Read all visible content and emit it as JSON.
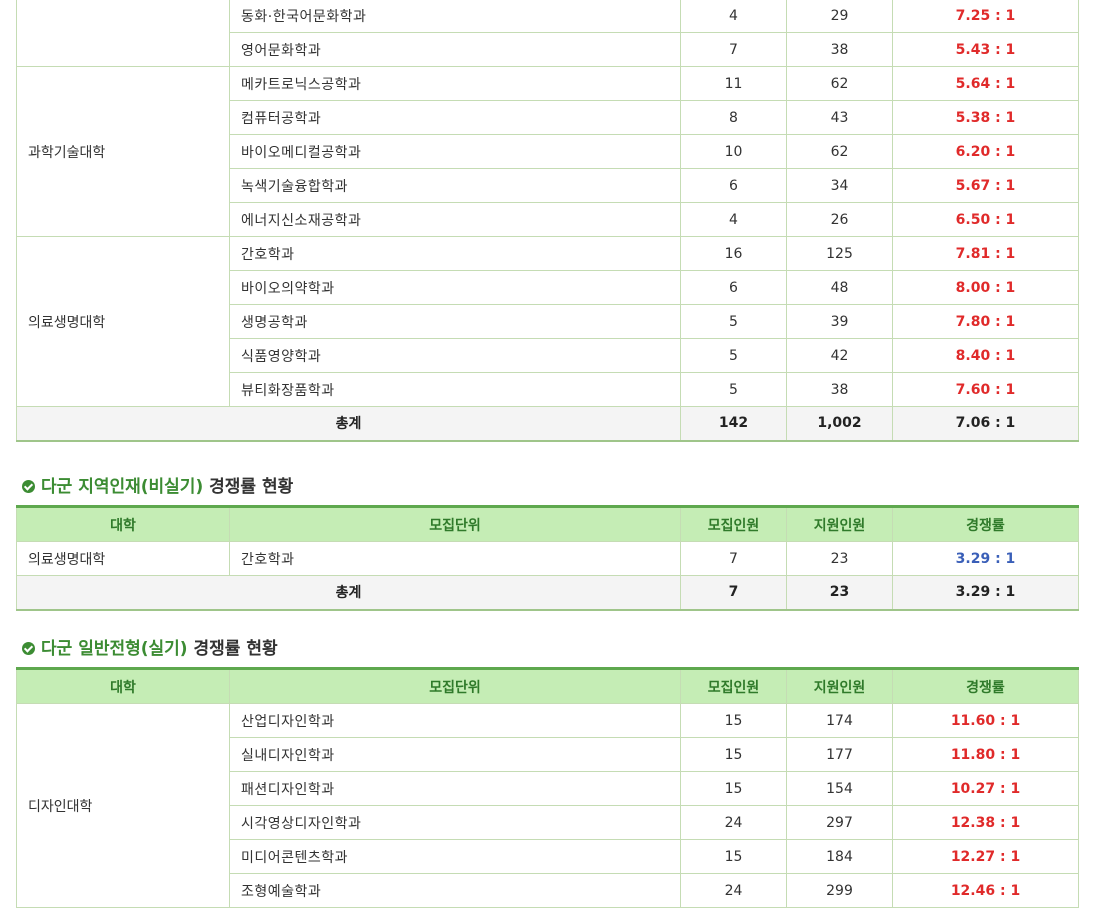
{
  "table1": {
    "groups": [
      {
        "univ": "",
        "rows": [
          {
            "unit": "동화·한국어문화학과",
            "quota": "4",
            "applicants": "29",
            "rate": "7.25 : 1"
          },
          {
            "unit": "영어문화학과",
            "quota": "7",
            "applicants": "38",
            "rate": "5.43 : 1"
          }
        ]
      },
      {
        "univ": "과학기술대학",
        "rows": [
          {
            "unit": "메카트로닉스공학과",
            "quota": "11",
            "applicants": "62",
            "rate": "5.64 : 1"
          },
          {
            "unit": "컴퓨터공학과",
            "quota": "8",
            "applicants": "43",
            "rate": "5.38 : 1"
          },
          {
            "unit": "바이오메디컬공학과",
            "quota": "10",
            "applicants": "62",
            "rate": "6.20 : 1"
          },
          {
            "unit": "녹색기술융합학과",
            "quota": "6",
            "applicants": "34",
            "rate": "5.67 : 1"
          },
          {
            "unit": "에너지신소재공학과",
            "quota": "4",
            "applicants": "26",
            "rate": "6.50 : 1"
          }
        ]
      },
      {
        "univ": "의료생명대학",
        "rows": [
          {
            "unit": "간호학과",
            "quota": "16",
            "applicants": "125",
            "rate": "7.81 : 1"
          },
          {
            "unit": "바이오의약학과",
            "quota": "6",
            "applicants": "48",
            "rate": "8.00 : 1"
          },
          {
            "unit": "생명공학과",
            "quota": "5",
            "applicants": "39",
            "rate": "7.80 : 1"
          },
          {
            "unit": "식품영양학과",
            "quota": "5",
            "applicants": "42",
            "rate": "8.40 : 1"
          },
          {
            "unit": "뷰티화장품학과",
            "quota": "5",
            "applicants": "38",
            "rate": "7.60 : 1"
          }
        ]
      }
    ],
    "total": {
      "label": "총계",
      "quota": "142",
      "applicants": "1,002",
      "rate": "7.06 : 1"
    }
  },
  "section2": {
    "title_green": "다군 지역인재(비실기)",
    "title_dark": " 경쟁률 현황",
    "headers": [
      "대학",
      "모집단위",
      "모집인원",
      "지원인원",
      "경쟁률"
    ],
    "rows": [
      {
        "univ": "의료생명대학",
        "unit": "간호학과",
        "quota": "7",
        "applicants": "23",
        "rate": "3.29 : 1"
      }
    ],
    "total": {
      "label": "총계",
      "quota": "7",
      "applicants": "23",
      "rate": "3.29 : 1"
    }
  },
  "section3": {
    "title_green": "다군 일반전형(실기)",
    "title_dark": " 경쟁률 현황",
    "headers": [
      "대학",
      "모집단위",
      "모집인원",
      "지원인원",
      "경쟁률"
    ],
    "univ": "디자인대학",
    "rows": [
      {
        "unit": "산업디자인학과",
        "quota": "15",
        "applicants": "174",
        "rate": "11.60 : 1"
      },
      {
        "unit": "실내디자인학과",
        "quota": "15",
        "applicants": "177",
        "rate": "11.80 : 1"
      },
      {
        "unit": "패션디자인학과",
        "quota": "15",
        "applicants": "154",
        "rate": "10.27 : 1"
      },
      {
        "unit": "시각영상디자인학과",
        "quota": "24",
        "applicants": "297",
        "rate": "12.38 : 1"
      },
      {
        "unit": "미디어콘텐츠학과",
        "quota": "15",
        "applicants": "184",
        "rate": "12.27 : 1"
      },
      {
        "unit": "조형예술학과",
        "quota": "24",
        "applicants": "299",
        "rate": "12.46 : 1"
      }
    ]
  },
  "colors": {
    "rate_high": "#e02a2a",
    "rate_low": "#3a5fb8",
    "header_bg": "#c5edb5",
    "accent": "#3c8c33"
  },
  "icons": {
    "section_marker": "check-circle-icon"
  }
}
